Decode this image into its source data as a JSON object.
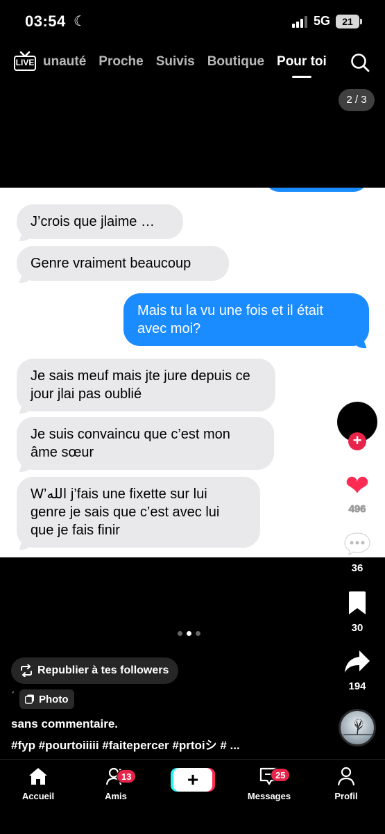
{
  "status_bar": {
    "time": "03:54",
    "network": "5G",
    "battery": "21"
  },
  "top_nav": {
    "live_label": "LIVE",
    "tabs": [
      {
        "label": "unauté"
      },
      {
        "label": "Proche"
      },
      {
        "label": "Suivis"
      },
      {
        "label": "Boutique"
      },
      {
        "label": "Pour toi"
      }
    ],
    "active_tab": "Pour toi"
  },
  "photo_counter": "2 / 3",
  "messages": [
    {
      "type": "received",
      "text": "J’crois que jlaime …"
    },
    {
      "type": "received",
      "text": "Genre vraiment beaucoup"
    },
    {
      "type": "sent",
      "text": "Mais tu la vu une fois et il était avec moi?"
    },
    {
      "type": "received",
      "text": "Je sais meuf mais jte jure depuis ce jour jlai pas oublié"
    },
    {
      "type": "received",
      "text": "Je suis convaincu que c’est mon âme sœur"
    },
    {
      "type": "received",
      "text": "W’الله j’fais une fixette sur lui genre je sais que c’est avec lui que je fais finir"
    }
  ],
  "actions": {
    "likes": "496",
    "comments": "36",
    "saves": "30",
    "shares": "194"
  },
  "repost_label": "Republier à tes followers",
  "tick": "ˊ",
  "photo_badge": "Photo",
  "caption": "sans commentaire.",
  "hashtags": "#fyp #pourtoiiiii #faitepercer #prtoiシ # ...",
  "bottom_nav": {
    "home": "Accueil",
    "friends": "Amis",
    "friends_badge": "13",
    "create": "+",
    "messages": "Messages",
    "messages_badge": "25",
    "profile": "Profil"
  },
  "colors": {
    "like": "#fe2c55",
    "sent_bubble": "#1a8cff",
    "received_bubble": "#e9e9eb",
    "badge": "#e8244b"
  }
}
